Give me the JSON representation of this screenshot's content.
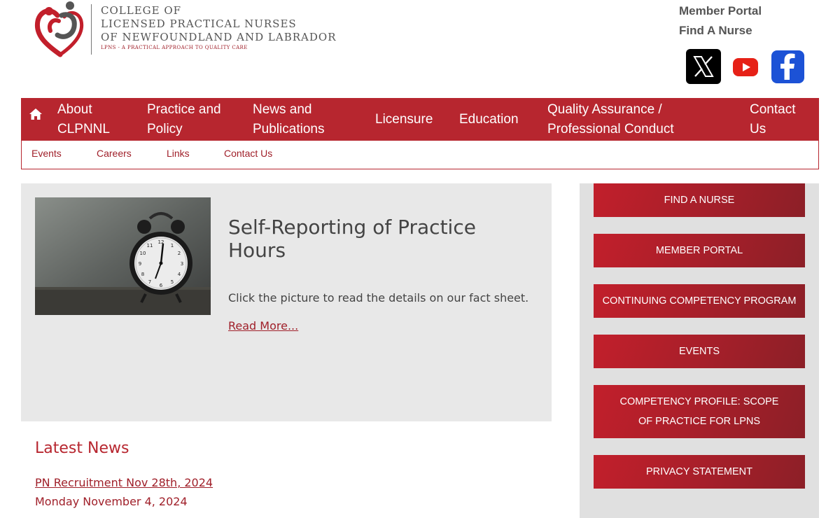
{
  "header": {
    "logo": {
      "line1": "COLLEGE OF",
      "line2": "LICENSED PRACTICAL NURSES",
      "line3": "OF NEWFOUNDLAND AND LABRADOR",
      "tagline": "LPNS - A PRACTICAL APPROACH TO QUALITY CARE"
    },
    "top_links": [
      "Member Portal",
      "Find A Nurse"
    ],
    "social": [
      {
        "icon": "x-logo-icon"
      },
      {
        "icon": "youtube-icon"
      },
      {
        "icon": "facebook-icon"
      }
    ]
  },
  "nav": {
    "home_icon": "home-icon",
    "items": [
      {
        "label": "About CLPNNL"
      },
      {
        "label": "Practice and Policy"
      },
      {
        "label": "News and Publications"
      },
      {
        "label": "Licensure"
      },
      {
        "label": "Education"
      },
      {
        "label": "Quality Assurance / Professional Conduct"
      },
      {
        "label": "Contact Us"
      }
    ]
  },
  "subnav": {
    "items": [
      "Events",
      "Careers",
      "Links",
      "Contact Us"
    ]
  },
  "feature": {
    "title": "Self-Reporting of Practice Hours",
    "description": "Click the picture to read the details on our fact sheet.",
    "read_more": "Read More..."
  },
  "news": {
    "heading": "Latest News",
    "items": [
      {
        "title": "PN Recruitment Nov 28th, 2024",
        "date": "Monday November 4, 2024"
      }
    ]
  },
  "sidebar": {
    "buttons": [
      "FIND A NURSE",
      "MEMBER PORTAL",
      "CONTINUING COMPETENCY PROGRAM",
      "EVENTS",
      "COMPETENCY PROFILE: SCOPE OF PRACTICE FOR LPNS",
      "PRIVACY STATEMENT"
    ]
  },
  "colors": {
    "brand_red": "#b7262f",
    "link_red": "#a0202a",
    "panel_gray": "#e8e8e8",
    "sidebar_gray": "#e0e0e0"
  }
}
